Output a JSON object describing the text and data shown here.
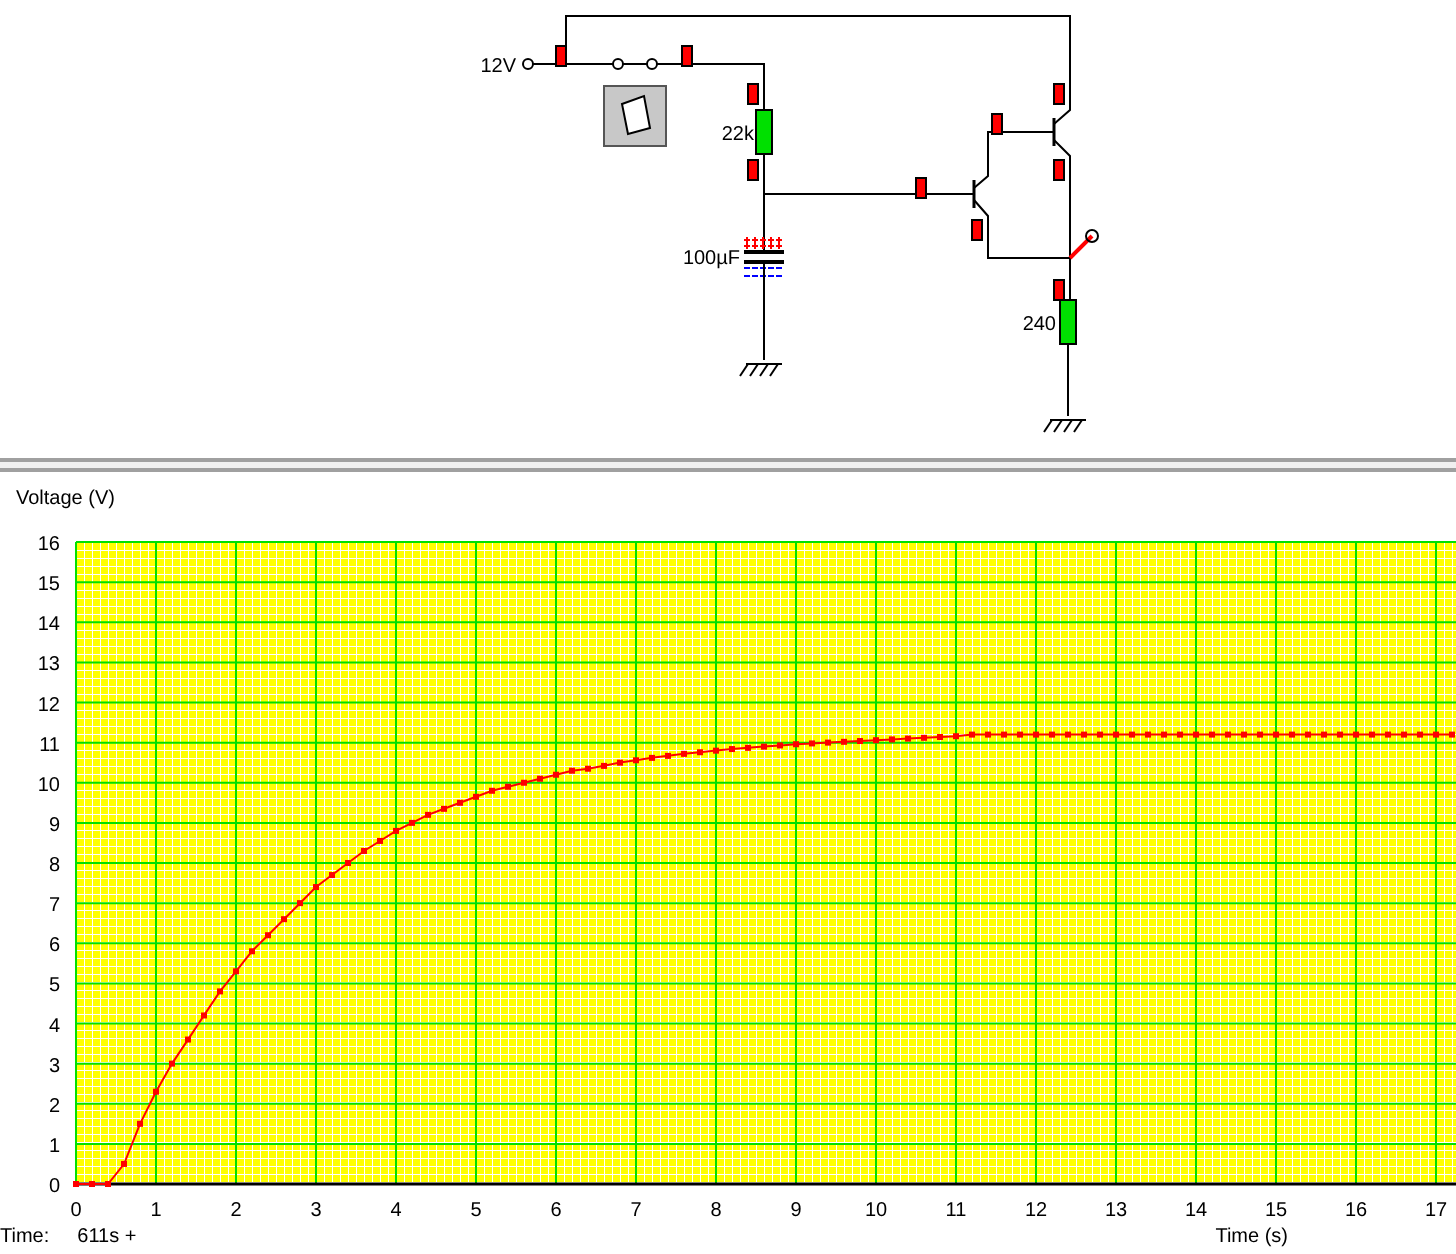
{
  "circuit": {
    "labels": [
      {
        "kind": "supply",
        "text": "12V"
      },
      {
        "kind": "r1",
        "text": "22k"
      },
      {
        "kind": "cap",
        "text": "100µF"
      },
      {
        "kind": "r2",
        "text": "240"
      }
    ],
    "switch": {
      "on": true
    }
  },
  "graph": {
    "chart_data": {
      "type": "line",
      "grid": true,
      "xlabel": "Time (s)",
      "ylabel": "Voltage (V)",
      "xlim": [
        0,
        17.25
      ],
      "ylim": [
        0,
        16
      ],
      "xticks": [
        0,
        1,
        2,
        3,
        4,
        5,
        6,
        7,
        8,
        9,
        10,
        11,
        12,
        13,
        14,
        15,
        16,
        17
      ],
      "yticks": [
        0,
        1,
        2,
        3,
        4,
        5,
        6,
        7,
        8,
        9,
        10,
        11,
        12,
        13,
        14,
        15,
        16
      ],
      "x": [
        0,
        0.2,
        0.4,
        0.6,
        0.8,
        1,
        1.2,
        1.4,
        1.6,
        1.8,
        2,
        2.2,
        2.4,
        2.6,
        2.8,
        3,
        3.2,
        3.4,
        3.6,
        3.8,
        4,
        4.2,
        4.4,
        4.6,
        4.8,
        5,
        5.2,
        5.4,
        5.6,
        5.8,
        6,
        6.2,
        6.4,
        6.6,
        6.8,
        7,
        7.2,
        7.4,
        7.6,
        7.8,
        8,
        8.2,
        8.4,
        8.6,
        8.8,
        9,
        9.2,
        9.4,
        9.6,
        9.8,
        10,
        10.2,
        10.4,
        10.6,
        10.8,
        11,
        11.2,
        11.4,
        11.6,
        11.8,
        12,
        12.2,
        12.4,
        12.6,
        12.8,
        13,
        13.2,
        13.4,
        13.6,
        13.8,
        14,
        14.2,
        14.4,
        14.6,
        14.8,
        15,
        15.2,
        15.4,
        15.6,
        15.8,
        16,
        16.2,
        16.4,
        16.6,
        16.8,
        17,
        17.2
      ],
      "series": [
        {
          "color": "#ff0000",
          "marker": "square",
          "values": [
            0,
            0,
            0,
            0.5,
            1.5,
            2.3,
            3.0,
            3.6,
            4.2,
            4.8,
            5.3,
            5.8,
            6.2,
            6.6,
            7.0,
            7.4,
            7.7,
            8.0,
            8.3,
            8.55,
            8.8,
            9.0,
            9.2,
            9.35,
            9.5,
            9.65,
            9.8,
            9.9,
            10.0,
            10.1,
            10.2,
            10.3,
            10.35,
            10.42,
            10.5,
            10.56,
            10.62,
            10.67,
            10.72,
            10.76,
            10.8,
            10.84,
            10.87,
            10.9,
            10.93,
            10.96,
            10.98,
            11.0,
            11.02,
            11.04,
            11.06,
            11.08,
            11.1,
            11.12,
            11.14,
            11.16,
            11.2,
            11.2,
            11.2,
            11.2,
            11.2,
            11.2,
            11.2,
            11.2,
            11.2,
            11.2,
            11.2,
            11.2,
            11.2,
            11.2,
            11.2,
            11.2,
            11.2,
            11.2,
            11.2,
            11.2,
            11.2,
            11.2,
            11.2,
            11.2,
            11.2,
            11.2,
            11.2,
            11.2,
            11.2,
            11.2,
            11.2
          ]
        }
      ]
    }
  },
  "status": {
    "label": "Time:",
    "value": "611s +"
  }
}
